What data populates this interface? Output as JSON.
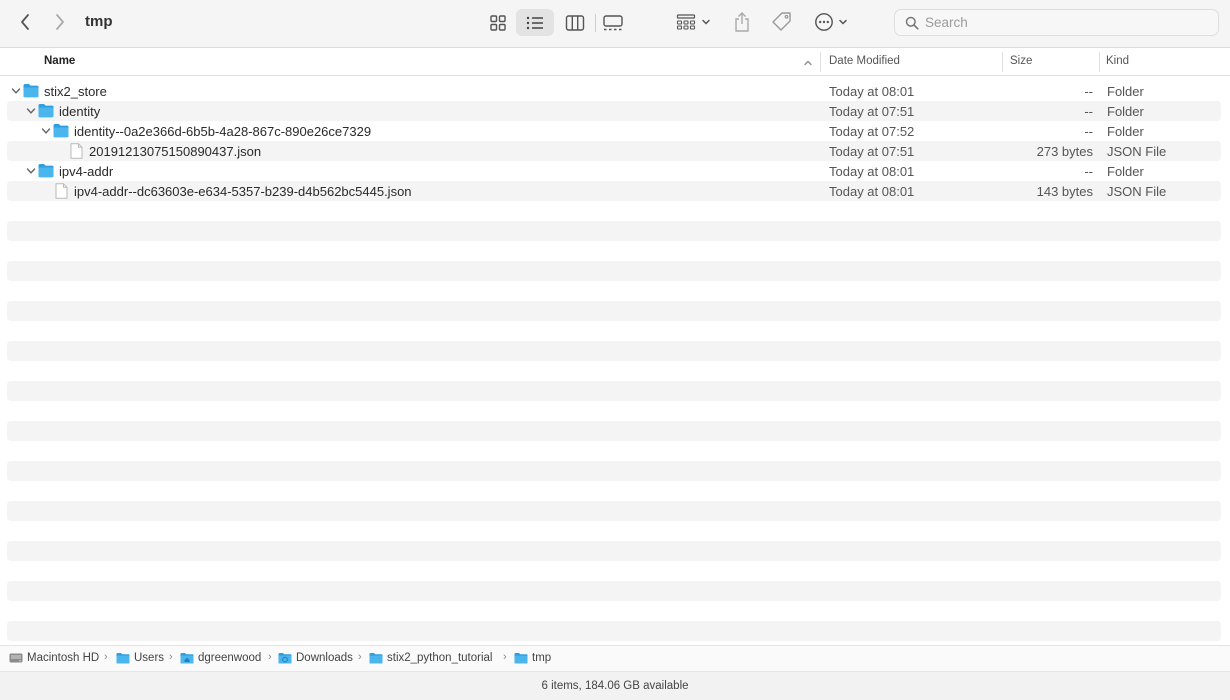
{
  "window": {
    "title": "tmp"
  },
  "toolbar": {
    "icons": [
      "chevron-left-icon",
      "chevron-right-icon",
      "icon-view-icon",
      "list-view-icon",
      "column-view-icon",
      "gallery-view-icon",
      "group-icon",
      "share-icon",
      "tag-icon",
      "more-icon"
    ],
    "active_view": "list"
  },
  "search": {
    "placeholder": "Search"
  },
  "columns": {
    "name": "Name",
    "date": "Date Modified",
    "size": "Size",
    "kind": "Kind"
  },
  "rows": [
    {
      "name": "stix2_store",
      "date": "Today at 08:01",
      "size": "--",
      "kind": "Folder",
      "type": "folder",
      "expanded": true,
      "level": 0
    },
    {
      "name": "identity",
      "date": "Today at 07:51",
      "size": "--",
      "kind": "Folder",
      "type": "folder",
      "expanded": true,
      "level": 1
    },
    {
      "name": "identity--0a2e366d-6b5b-4a28-867c-890e26ce7329",
      "date": "Today at 07:52",
      "size": "--",
      "kind": "Folder",
      "type": "folder",
      "expanded": true,
      "level": 2
    },
    {
      "name": "20191213075150890437.json",
      "date": "Today at 07:51",
      "size": "273 bytes",
      "kind": "JSON File",
      "type": "file",
      "expanded": false,
      "level": 3
    },
    {
      "name": "ipv4-addr",
      "date": "Today at 08:01",
      "size": "--",
      "kind": "Folder",
      "type": "folder",
      "expanded": true,
      "level": 1
    },
    {
      "name": "ipv4-addr--dc63603e-e634-5357-b239-d4b562bc5445.json",
      "date": "Today at 08:01",
      "size": "143 bytes",
      "kind": "JSON File",
      "type": "file",
      "expanded": false,
      "level": 2
    }
  ],
  "path": [
    {
      "label": "Macintosh HD",
      "icon": "hard-drive-icon"
    },
    {
      "label": "Users",
      "icon": "folder-icon"
    },
    {
      "label": "dgreenwood",
      "icon": "home-folder-icon"
    },
    {
      "label": "Downloads",
      "icon": "downloads-folder-icon"
    },
    {
      "label": "stix2_python_tutorial",
      "icon": "folder-icon"
    },
    {
      "label": "tmp",
      "icon": "folder-icon"
    }
  ],
  "status": {
    "text": "6 items, 184.06 GB available"
  },
  "colors": {
    "folder": "#4bb5ee",
    "folder_tab": "#2f9fe0",
    "stripe": "#f4f4f4",
    "active_view": "#e3e3e3"
  }
}
